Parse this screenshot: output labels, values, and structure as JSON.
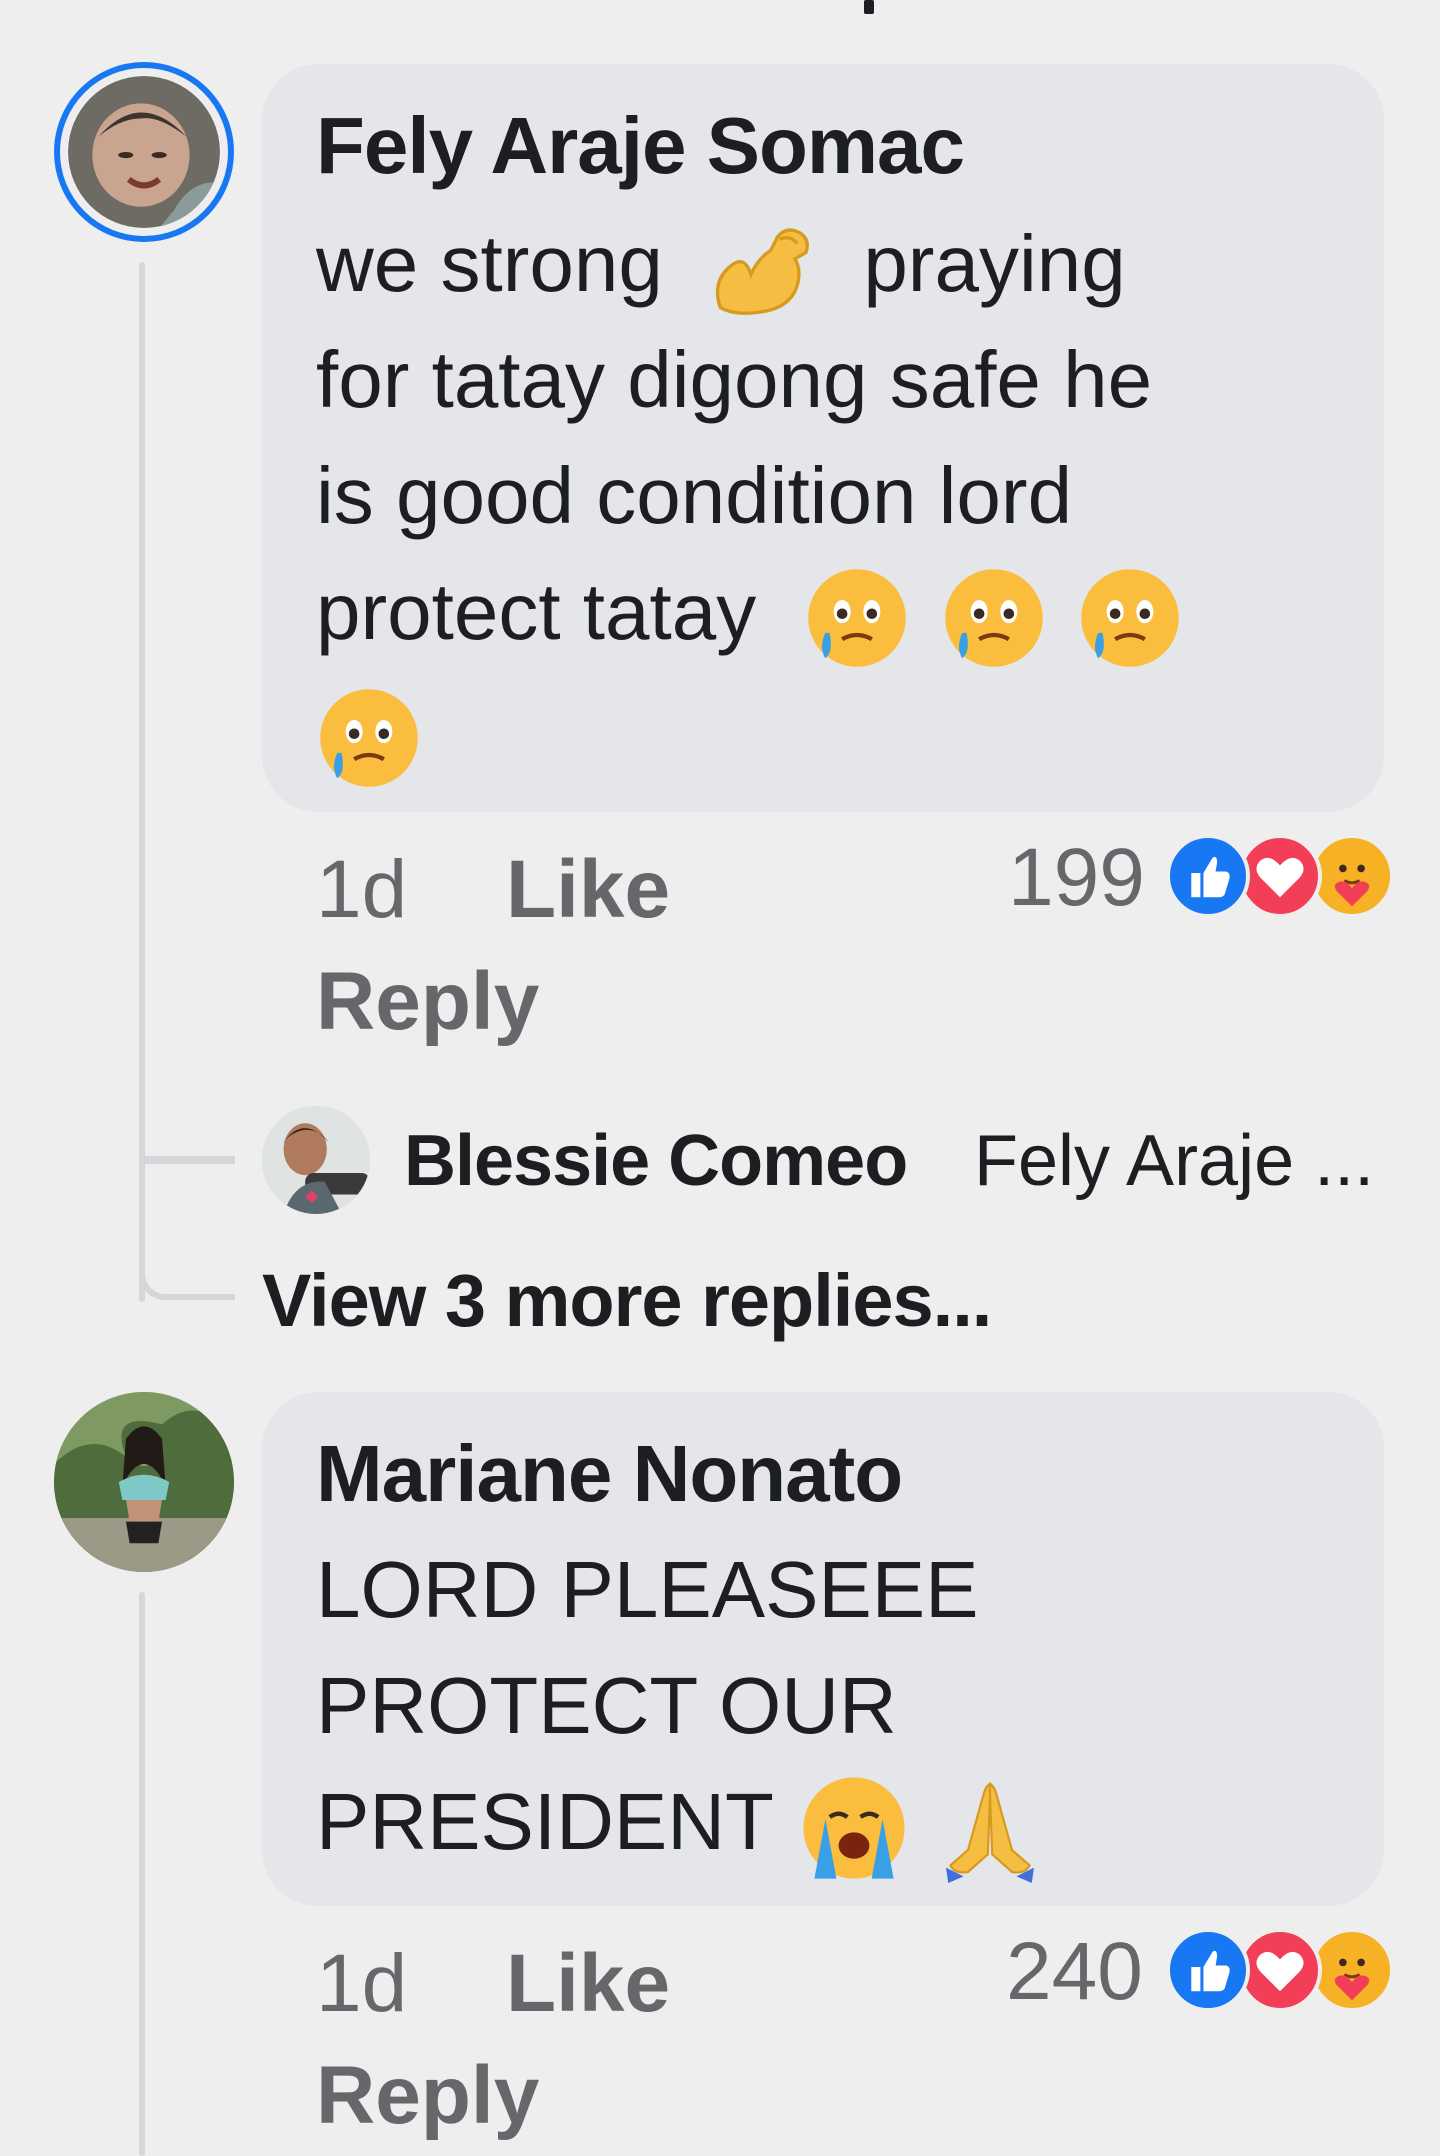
{
  "comments": [
    {
      "author": "Fely Araje Somac",
      "body_lines": [
        "we strong",
        "praying",
        "for tatay digong safe he",
        "is good condition lord",
        "protect tatay"
      ],
      "emojis": [
        "flexed-biceps-emoji",
        "face-holding-back-tears-emoji"
      ],
      "time": "1d",
      "like_label": "Like",
      "reply_label": "Reply",
      "reaction_count": "199",
      "reactions": [
        "like-reaction-icon",
        "love-reaction-icon",
        "care-reaction-icon"
      ]
    },
    {
      "author": "Mariane Nonato",
      "body_lines": [
        "LORD PLEASEEE",
        "PROTECT OUR",
        "PRESIDENT"
      ],
      "emojis": [
        "loudly-crying-face-emoji",
        "folded-hands-emoji"
      ],
      "time": "1d",
      "like_label": "Like",
      "reply_label": "Reply",
      "reaction_count": "240",
      "reactions": [
        "like-reaction-icon",
        "love-reaction-icon",
        "care-reaction-icon"
      ]
    }
  ],
  "reply_preview": {
    "author": "Blessie Comeo",
    "text": "Fely Araje ..."
  },
  "view_more_label": "View 3 more replies...",
  "colors": {
    "background": "#eeeeef",
    "bubble": "#e4e6ea",
    "meta_text": "#65676b",
    "story_ring": "#1877f2",
    "like_blue": "#1877f2",
    "love_red": "#f33e58",
    "care_yellow": "#f7b125"
  }
}
